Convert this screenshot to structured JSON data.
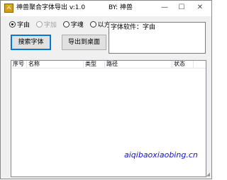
{
  "window": {
    "title": "神兽聚合字体导出 v:1.0",
    "author": "BY: 神兽",
    "minimize_glyph": "—",
    "maximize_glyph": "☐",
    "close_glyph": "✕",
    "app_icon": "sword-icon"
  },
  "options": {
    "items": [
      {
        "label": "字由",
        "checked": true,
        "disabled": false
      },
      {
        "label": "字加",
        "checked": false,
        "disabled": true
      },
      {
        "label": "字魂",
        "checked": false,
        "disabled": false
      },
      {
        "label": "以方",
        "checked": false,
        "disabled": false
      }
    ]
  },
  "buttons": {
    "search": "搜索字体",
    "export": "导出到桌面"
  },
  "info": {
    "text": "字体软件：字由"
  },
  "list": {
    "columns": [
      "序号",
      "名称",
      "类型",
      "路径",
      "状态"
    ],
    "rows": []
  },
  "watermark": "aiqibaoxiaobing.cn",
  "colors": {
    "accent": "#0078d7",
    "watermark": "#1010d0"
  }
}
